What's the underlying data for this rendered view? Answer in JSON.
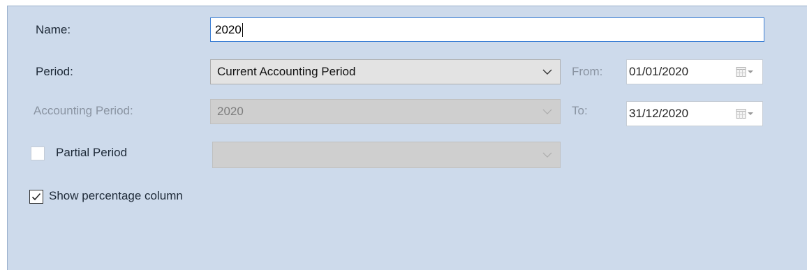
{
  "form": {
    "name": {
      "label": "Name:",
      "value": "2020"
    },
    "period": {
      "label": "Period:",
      "selected": "Current Accounting Period"
    },
    "from": {
      "label": "From:",
      "value": "01/01/2020"
    },
    "accounting_period": {
      "label": "Accounting Period:",
      "selected": "2020",
      "disabled": true
    },
    "to": {
      "label": "To:",
      "value": "31/12/2020"
    },
    "partial_period": {
      "label": "Partial Period",
      "checked": false,
      "selected": ""
    },
    "show_percentage": {
      "label": "Show percentage column",
      "checked": true
    }
  },
  "colors": {
    "panel_background": "#cddaeb",
    "focus_border": "#3c7fd4",
    "combo_background": "#e3e3e3",
    "disabled_text": "#8a94a2"
  },
  "icons": {
    "dropdown": "chevron-down-icon",
    "calendar": "calendar-icon",
    "check": "checkmark-icon"
  }
}
